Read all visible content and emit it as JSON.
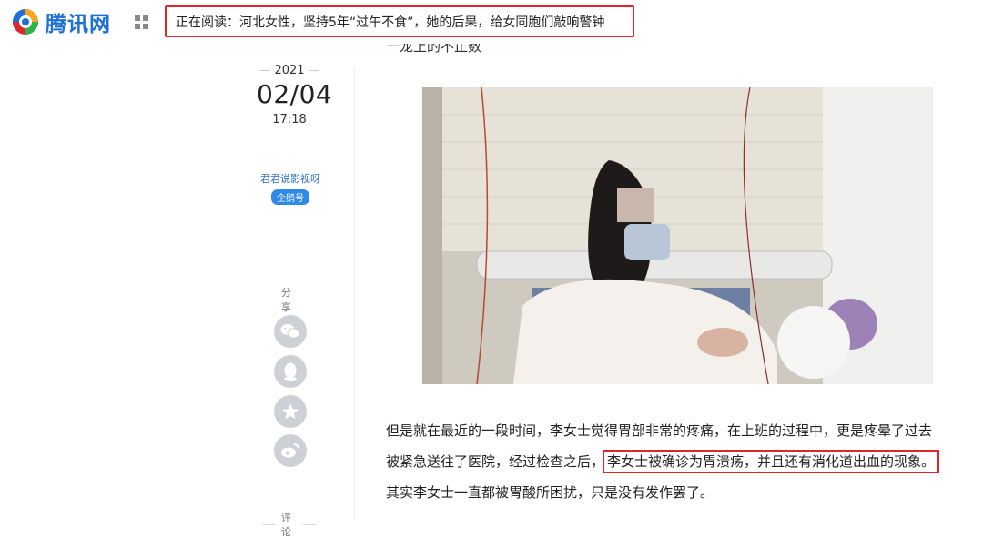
{
  "header": {
    "logo_text": "腾讯网",
    "reading_label": "正在阅读：河北女性，坚持5年“过午不食”，她的后果，给女同胞们敲响警钟"
  },
  "article_meta": {
    "year": "2021",
    "month_day": "02/04",
    "time": "17:18",
    "author": "君君说影视呀",
    "author_badge": "企鹅号"
  },
  "share": {
    "label": "分享",
    "buttons": [
      "wechat-icon",
      "qq-icon",
      "favorite-icon",
      "weibo-icon"
    ]
  },
  "comment": {
    "label": "评论"
  },
  "article": {
    "cut_line": "一龙上的不正数",
    "paragraph_line1": "但是就在最近的一段时间，李女士觉得胃部非常的疼痛，在上班的过程中，更是疼晕了过去",
    "paragraph_line2_pre": "被紧急送往了医院，经过检查之后，",
    "paragraph_line2_highlight": "李女士被确诊为胃溃疡，并且还有消化道出血的现象。",
    "paragraph_line3": "其实李女士一直都被胃酸所困扰，只是没有发作罢了。"
  },
  "colors": {
    "highlight_border": "#e0262d",
    "brand_blue": "#1b6fd6",
    "badge_blue": "#2f8ae6",
    "share_button": "#cdd0d5"
  }
}
